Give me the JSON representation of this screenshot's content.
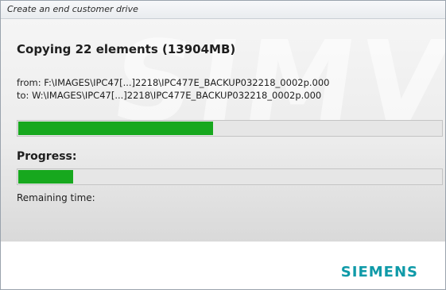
{
  "window": {
    "title": "Create an end customer drive"
  },
  "copy": {
    "heading": "Copying 22 elements (13904MB)",
    "from": "from: F:\\IMAGES\\IPC47[...]2218\\IPC477E_BACKUP032218_0002p.000",
    "to": "to: W:\\IMAGES\\IPC47[...]2218\\IPC477E_BACKUP032218_0002p.000",
    "file_progress_fraction": 0.46
  },
  "overall": {
    "label": "Progress:",
    "progress_fraction": 0.13,
    "remaining_label": "Remaining time:"
  },
  "footer": {
    "logo": "SIEMENS"
  },
  "colors": {
    "progress_green": "#17a81e",
    "logo_teal": "#0f9aa8"
  }
}
